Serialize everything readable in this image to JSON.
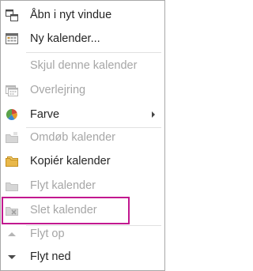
{
  "menu": {
    "items": [
      {
        "label": "Åbn i nyt vindue",
        "icon": "open-new-window-icon",
        "enabled": true
      },
      {
        "label": "Ny kalender...",
        "icon": "new-calendar-icon",
        "enabled": true
      },
      {
        "label": "Skjul denne kalender",
        "icon": "",
        "enabled": false
      },
      {
        "label": "Overlejring",
        "icon": "overlay-icon",
        "enabled": false
      },
      {
        "label": "Farve",
        "icon": "color-icon",
        "enabled": true,
        "submenu": true
      },
      {
        "label": "Omdøb kalender",
        "icon": "rename-calendar-icon",
        "enabled": false
      },
      {
        "label": "Kopiér kalender",
        "icon": "copy-calendar-icon",
        "enabled": true
      },
      {
        "label": "Flyt kalender",
        "icon": "move-calendar-icon",
        "enabled": false
      },
      {
        "label": "Slet kalender",
        "icon": "delete-calendar-icon",
        "enabled": false,
        "highlighted": true
      },
      {
        "label": "Flyt op",
        "icon": "move-up-icon",
        "enabled": false
      },
      {
        "label": "Flyt ned",
        "icon": "move-down-icon",
        "enabled": true
      }
    ]
  },
  "colors": {
    "text": "#262626",
    "disabled_text": "#a6a6a6",
    "highlight_border": "#c2188f",
    "border": "#a8a8a8"
  }
}
